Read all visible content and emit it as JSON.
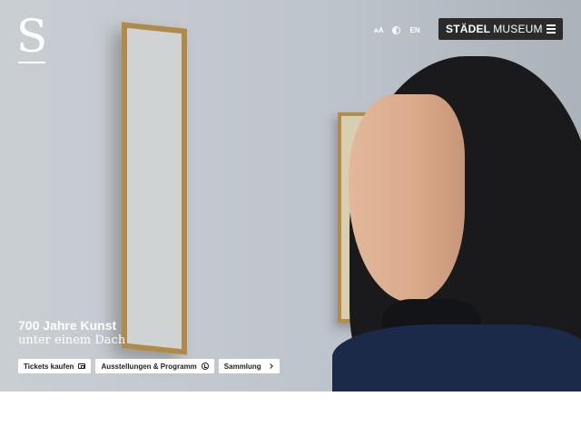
{
  "header": {
    "logo_letter": "S",
    "text_size_label": "ᴀA",
    "language_label": "EN",
    "brand_strong": "STÄDEL",
    "brand_light": "MUSEUM"
  },
  "hero": {
    "headline": "700 Jahre Kunst",
    "subline": "unter einem Dach"
  },
  "actions": {
    "tickets_label": "Tickets kaufen",
    "program_label": "Ausstellungen & Programm",
    "collection_label": "Sammlung"
  },
  "colors": {
    "brand_button_bg": "#2b2b2b",
    "cta_bg": "#ffffff"
  },
  "icons": [
    "ticket-icon",
    "clock-icon",
    "chevron-right-icon",
    "contrast-icon",
    "menu-icon"
  ]
}
